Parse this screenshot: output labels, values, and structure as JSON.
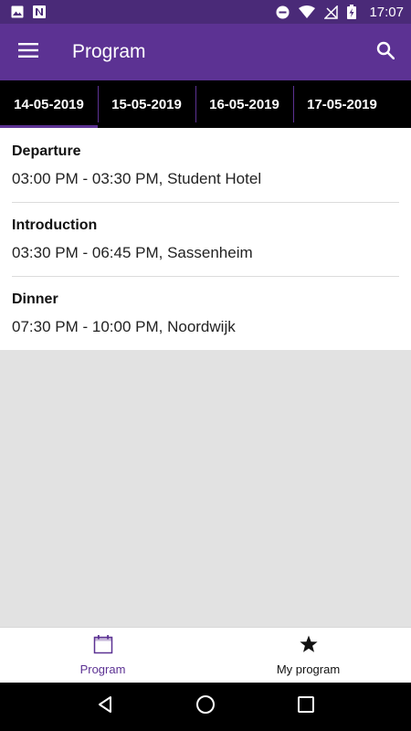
{
  "status_bar": {
    "time": "17:07",
    "icons": [
      "image-icon",
      "n-icon",
      "dnd-icon",
      "wifi-icon",
      "no-signal-icon",
      "battery-charging-icon"
    ]
  },
  "app_bar": {
    "title": "Program",
    "menu_icon": "hamburger-menu-icon",
    "search_icon": "search-icon",
    "color": "#5c3293"
  },
  "tabs": [
    {
      "label": "14-05-2019",
      "active": true
    },
    {
      "label": "15-05-2019",
      "active": false
    },
    {
      "label": "16-05-2019",
      "active": false
    },
    {
      "label": "17-05-2019",
      "active": false
    }
  ],
  "events": [
    {
      "title": "Departure",
      "detail": "03:00 PM - 03:30 PM, Student Hotel"
    },
    {
      "title": "Introduction",
      "detail": "03:30 PM - 06:45 PM, Sassenheim"
    },
    {
      "title": "Dinner",
      "detail": "07:30 PM - 10:00 PM, Noordwijk"
    }
  ],
  "bottom_nav": [
    {
      "label": "Program",
      "icon": "calendar-icon",
      "active": true
    },
    {
      "label": "My program",
      "icon": "star-icon",
      "active": false
    }
  ],
  "system_nav": [
    "back-icon",
    "home-icon",
    "recents-icon"
  ]
}
